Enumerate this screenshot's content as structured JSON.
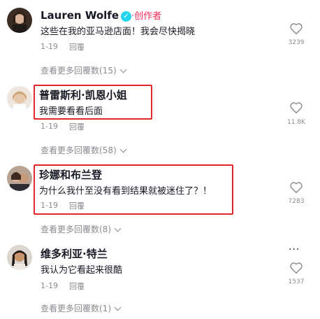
{
  "comments": [
    {
      "author": "Lauren Wolfe",
      "badge": "·创作者",
      "text": "这些在我的亚马逊店面！我会尽快揭晓",
      "date": "1-19",
      "reply": "回覆",
      "likes": "3239",
      "more": "查看更多回覆数(15)"
    },
    {
      "author": "普雷斯利·凯恩小姐",
      "text": "我需要看看后面",
      "date": "1-19",
      "reply": "回覆",
      "likes": "11.8K",
      "more": "查看更多回覆数(58)"
    },
    {
      "author": "珍娜和布兰登",
      "text": "为什么我什至没有看到结果就被迷住了？！",
      "date": "1-19",
      "reply": "回覆",
      "likes": "7283",
      "more": "查看更多回覆数(8)"
    },
    {
      "author": "维多利亚·特兰",
      "text": "我认为它看起来很酷",
      "date": "1-19",
      "reply": "回覆",
      "likes": "1537",
      "more": "查看更多回覆数(1)"
    }
  ],
  "icons": {
    "verified": "verified-check-icon",
    "like": "heart-outline-icon",
    "expand": "chevron-down-icon",
    "options": "more-dots-icon"
  },
  "colors": {
    "highlight": "#e0262a",
    "creator_badge": "#fe2c55",
    "verified": "#20d5ec",
    "muted": "#8a8b91"
  }
}
